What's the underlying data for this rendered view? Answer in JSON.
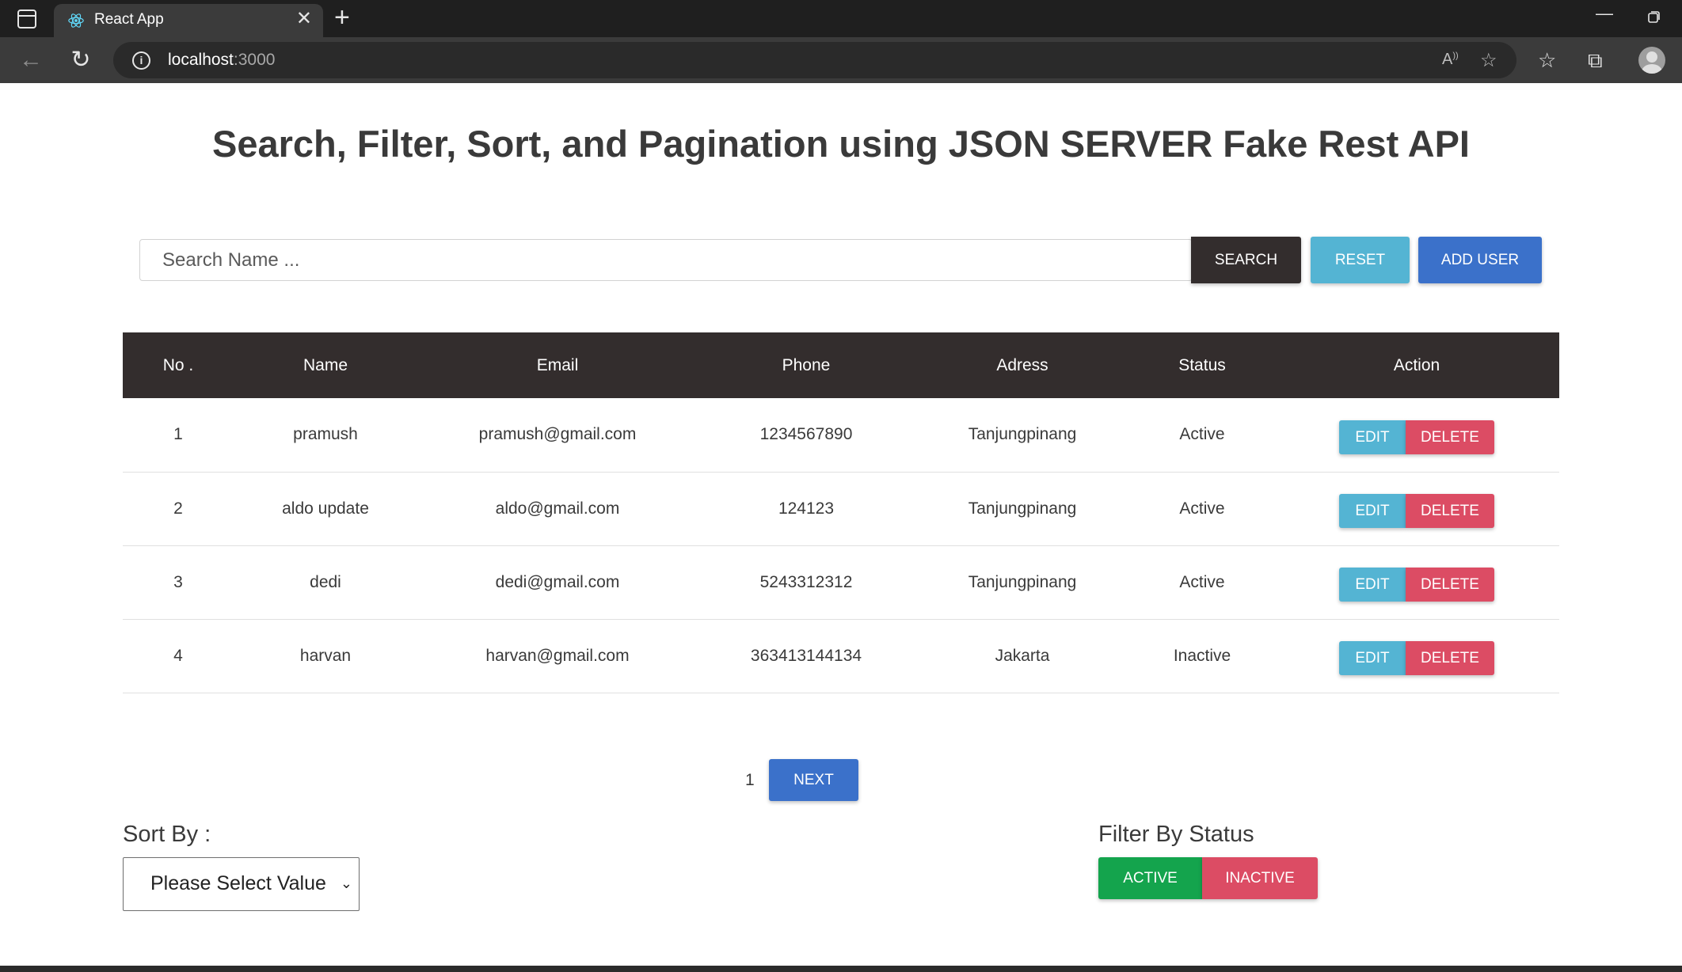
{
  "browser": {
    "tab_title": "React App",
    "tab_close_glyph": "✕",
    "new_tab_glyph": "+",
    "url_host": "localhost",
    "url_port": ":3000",
    "info_glyph": "i",
    "icons": [
      "sidebar-icon",
      "react-favicon-icon",
      "back-icon",
      "reload-icon",
      "read-aloud-icon",
      "add-favorite-icon",
      "favorites-icon",
      "collections-icon",
      "profile-icon",
      "minimize-icon",
      "restore-icon"
    ]
  },
  "page": {
    "title": "Search, Filter, Sort, and Pagination using JSON SERVER Fake Rest API"
  },
  "search": {
    "placeholder": "Search Name ...",
    "search_label": "SEARCH",
    "reset_label": "RESET",
    "add_label": "ADD USER"
  },
  "table": {
    "headers": {
      "no": "No .",
      "name": "Name",
      "email": "Email",
      "phone": "Phone",
      "address": "Adress",
      "status": "Status",
      "action": "Action"
    },
    "edit_label": "EDIT",
    "delete_label": "DELETE",
    "rows": [
      {
        "no": "1",
        "name": "pramush",
        "email": "pramush@gmail.com",
        "phone": "1234567890",
        "address": "Tanjungpinang",
        "status": "Active"
      },
      {
        "no": "2",
        "name": "aldo update",
        "email": "aldo@gmail.com",
        "phone": "124123",
        "address": "Tanjungpinang",
        "status": "Active"
      },
      {
        "no": "3",
        "name": "dedi",
        "email": "dedi@gmail.com",
        "phone": "5243312312",
        "address": "Tanjungpinang",
        "status": "Active"
      },
      {
        "no": "4",
        "name": "harvan",
        "email": "harvan@gmail.com",
        "phone": "363413144134",
        "address": "Jakarta",
        "status": "Inactive"
      }
    ]
  },
  "pagination": {
    "current_page": "1",
    "next_label": "NEXT"
  },
  "sort": {
    "label": "Sort By :",
    "selected": "Please Select Value"
  },
  "filter": {
    "label": "Filter By Status",
    "active_label": "ACTIVE",
    "inactive_label": "INACTIVE"
  },
  "colors": {
    "dark": "#332d2d",
    "info": "#54b4d3",
    "primary": "#3b71ca",
    "danger": "#dc4c64",
    "success": "#14a44d"
  }
}
